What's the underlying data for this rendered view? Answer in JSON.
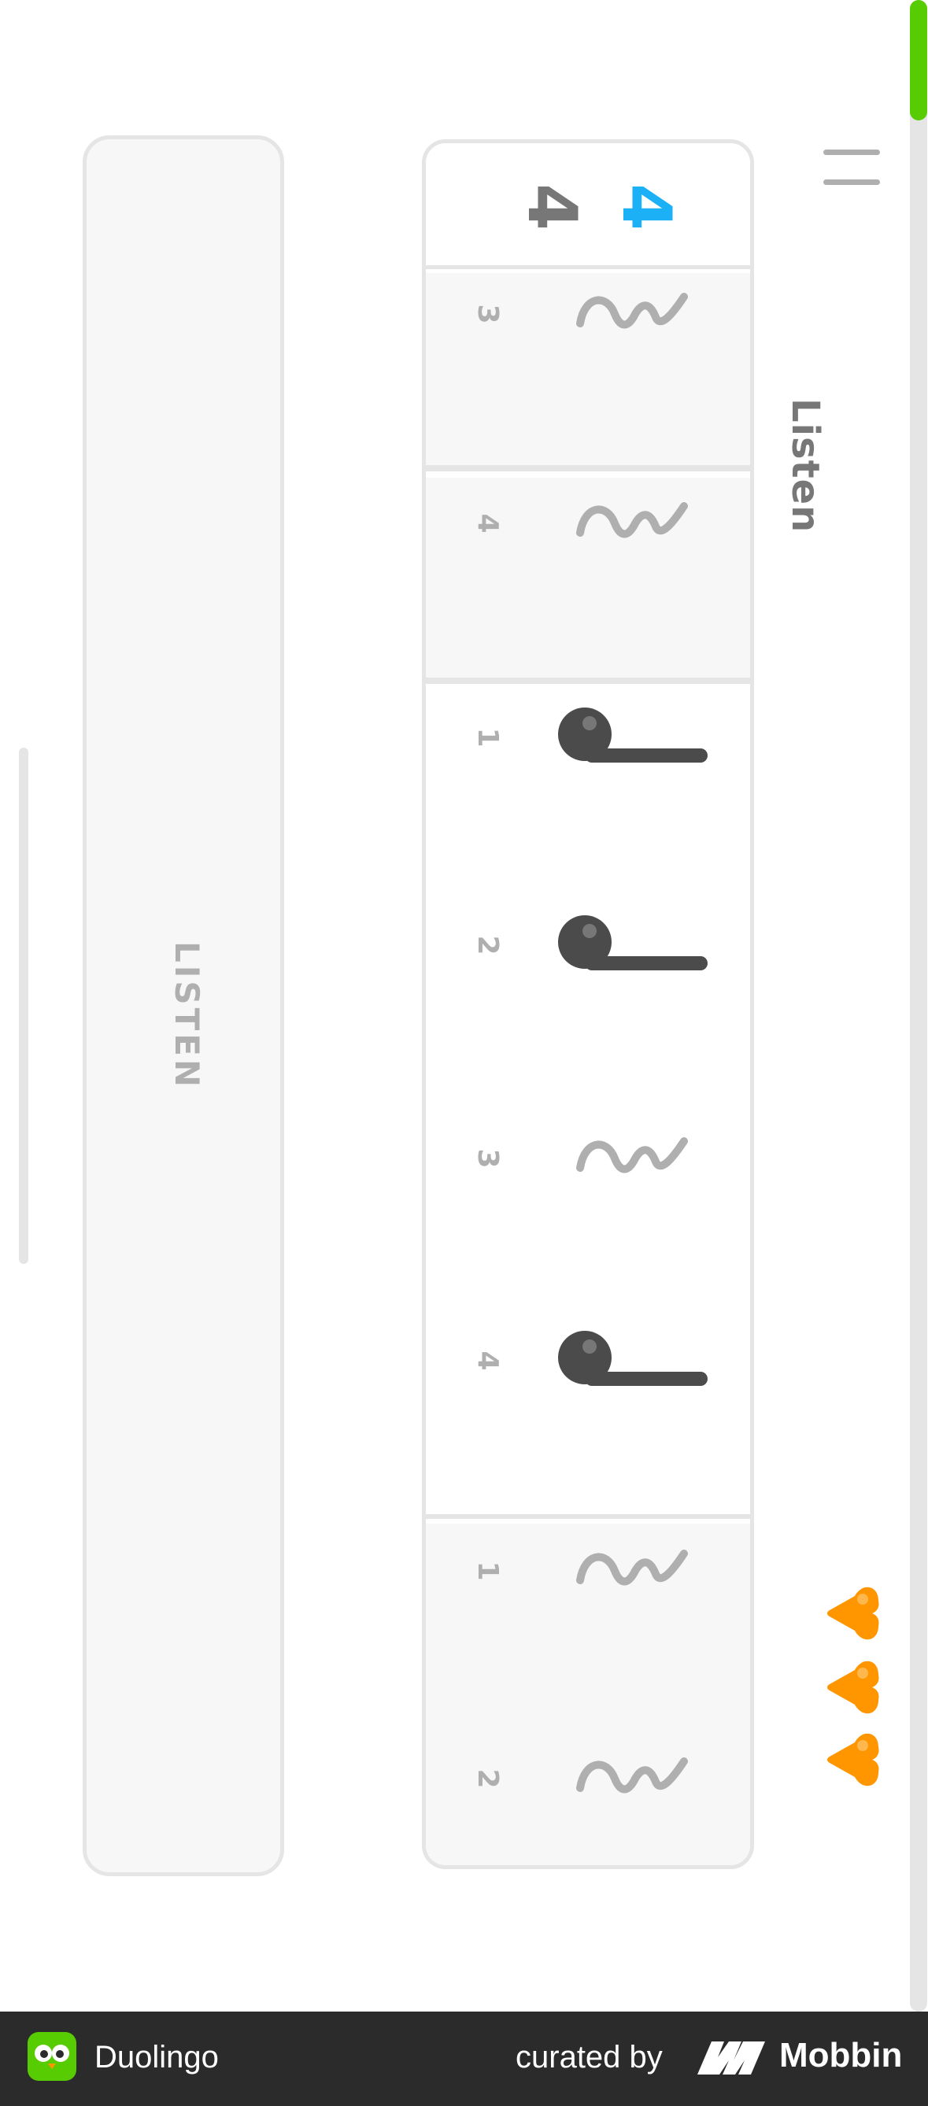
{
  "header": {
    "title": "Listen",
    "progress": 0.06
  },
  "lives": {
    "count": 3,
    "color": "#ff9600",
    "icon": "heart-icon"
  },
  "staff": {
    "time_signature": {
      "top": "4",
      "bottom": "4"
    },
    "measures": [
      {
        "state": "completed",
        "beats": [
          {
            "number": "3",
            "symbol": "rest"
          }
        ]
      },
      {
        "state": "completed",
        "beats": [
          {
            "number": "4",
            "symbol": "rest"
          }
        ]
      },
      {
        "state": "active",
        "beats": [
          {
            "number": "1",
            "symbol": "note"
          },
          {
            "number": "2",
            "symbol": "note"
          },
          {
            "number": "3",
            "symbol": "rest"
          },
          {
            "number": "4",
            "symbol": "note"
          }
        ]
      },
      {
        "state": "upcoming",
        "beats": [
          {
            "number": "1",
            "symbol": "rest"
          },
          {
            "number": "2",
            "symbol": "rest"
          }
        ]
      }
    ]
  },
  "listen_button": {
    "label": "LISTEN"
  },
  "colors": {
    "accent": "#1cb0f6",
    "progress": "#58cc02",
    "note": "#4b4b4b",
    "rest": "#afafaf"
  },
  "footer": {
    "app_name": "Duolingo",
    "curated_by": "curated by",
    "brand": "Mobbin"
  }
}
